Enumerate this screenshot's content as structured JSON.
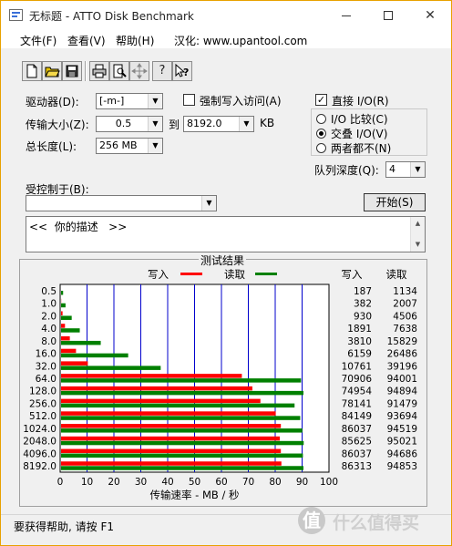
{
  "window": {
    "title": "无标题 - ATTO Disk Benchmark",
    "min_glyph": "minimize",
    "max_glyph": "maximize",
    "close_glyph": "✕"
  },
  "menu": {
    "file": "文件(F)",
    "view": "查看(V)",
    "help": "帮助(H)",
    "localized": "汉化: www.upantool.com"
  },
  "toolbar": {
    "icons": [
      "new-file-icon",
      "open-folder-icon",
      "save-icon",
      "print-icon",
      "print-preview-icon",
      "move-icon",
      "help-icon",
      "context-help-icon"
    ]
  },
  "form": {
    "drive_label": "驱动器(D):",
    "drive_value": "[-m-]",
    "transfer_label": "传输大小(Z):",
    "transfer_from": "0.5",
    "to_label": "到",
    "transfer_to": "8192.0",
    "unit": "KB",
    "total_label": "总长度(L):",
    "total_value": "256 MB",
    "force_write_label": "强制写入访问(A)",
    "force_write_checked": false,
    "direct_io_label": "直接 I/O(R)",
    "direct_io_checked": true,
    "io_compare_label": "I/O 比较(C)",
    "overlapped_io_label": "交叠 I/O(V)",
    "neither_label": "两者都不(N)",
    "selected_mode": "overlapped",
    "queue_label": "队列深度(Q):",
    "queue_value": "4",
    "controlled_by_label": "受控制于(B):",
    "controlled_by_value": "",
    "start_button": "开始(S)",
    "description": "<<  你的描述   >>"
  },
  "colors": {
    "write": "#ff0000",
    "read": "#008000",
    "grid": "#0000cc"
  },
  "chart_data": {
    "type": "bar",
    "title": "测试结果",
    "legend_write": "写入",
    "legend_read": "读取",
    "col_write": "写入",
    "col_read": "读取",
    "xlabel": "传输速率 - MB / 秒",
    "xlim": [
      0,
      100
    ],
    "xticks": [
      "0",
      "10",
      "20",
      "30",
      "40",
      "50",
      "60",
      "70",
      "80",
      "90",
      "100"
    ],
    "categories": [
      "0.5",
      "1.0",
      "2.0",
      "4.0",
      "8.0",
      "16.0",
      "32.0",
      "64.0",
      "128.0",
      "256.0",
      "512.0",
      "1024.0",
      "2048.0",
      "4096.0",
      "8192.0"
    ],
    "series": [
      {
        "name": "写入",
        "values": [
          0.2,
          0.4,
          0.9,
          1.8,
          3.6,
          5.9,
          10.3,
          67.6,
          71.5,
          74.5,
          80.2,
          82.1,
          81.7,
          82.1,
          82.3
        ]
      },
      {
        "name": "读取",
        "values": [
          1.1,
          2.0,
          4.3,
          7.3,
          15.1,
          25.3,
          37.4,
          89.6,
          90.5,
          87.2,
          89.3,
          90.1,
          90.6,
          90.3,
          90.5
        ]
      }
    ],
    "write_text": [
      "187",
      "382",
      "930",
      "1891",
      "3810",
      "6159",
      "10761",
      "70906",
      "74954",
      "78141",
      "84149",
      "86037",
      "85625",
      "86037",
      "86313"
    ],
    "read_text": [
      "1134",
      "2007",
      "4506",
      "7638",
      "15829",
      "26486",
      "39196",
      "94001",
      "94894",
      "91479",
      "93694",
      "94519",
      "95021",
      "94686",
      "94853"
    ]
  },
  "status": {
    "text": "要获得帮助, 请按 F1"
  },
  "watermark": {
    "badge": "值",
    "text": "什么值得买"
  }
}
